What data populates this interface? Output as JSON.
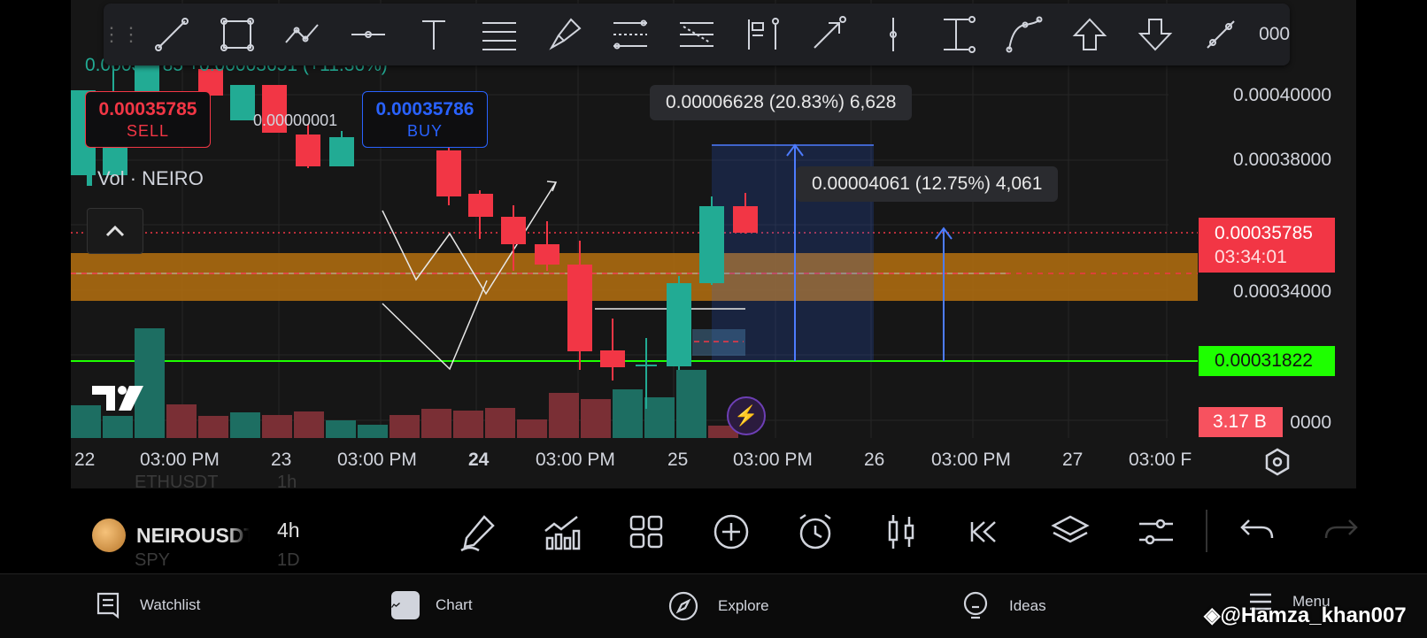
{
  "colors": {
    "up": "#22ab94",
    "down": "#f23645",
    "buy": "#2962ff",
    "support": "#1eff00",
    "zone": "#b5700f"
  },
  "toolbar": {
    "tools": [
      "trend-line-icon",
      "rectangle-icon",
      "path-icon",
      "horizontal-ray-icon",
      "text-icon",
      "parallel-channel-icon",
      "brush-icon",
      "fib-retracement-icon",
      "fib-extension-icon",
      "long-position-icon",
      "arrow-icon",
      "vertical-line-icon",
      "price-range-icon",
      "curve-icon",
      "arrow-up-icon",
      "arrow-down-icon",
      "info-line-icon"
    ],
    "peek_price": "000"
  },
  "chart": {
    "ohlc_change": "0.00035785 +0.00003651 (+11.36%)",
    "sell_price": "0.00035785",
    "sell_label": "SELL",
    "spread": "0.00000001",
    "buy_price": "0.00035786",
    "buy_label": "BUY",
    "volume_label": "Vol · NEIRO",
    "measure_1": "0.00006628 (20.83%) 6,628",
    "measure_2": "0.00004061 (12.75%) 4,061",
    "price_axis": [
      "0.00040000",
      "0.00038000",
      "0.00034000"
    ],
    "price_axis_bottom": "0000",
    "last_price": "0.00035785",
    "countdown": "03:34:01",
    "support_price": "0.00031822",
    "volume_value": "3.17 B",
    "time_axis": [
      "22",
      "03:00 PM",
      "23",
      "03:00 PM",
      "24",
      "03:00 PM",
      "25",
      "03:00 PM",
      "26",
      "03:00 PM",
      "27",
      "03:00 F"
    ]
  },
  "bottombar": {
    "ghost_symbol_top": "ETHUSDT",
    "ghost_interval_top": "1h",
    "symbol": "NEIROUSDT",
    "interval": "4h",
    "ghost_symbol_bottom": "SPY",
    "ghost_interval_bottom": "1D",
    "icons": [
      "draw-icon",
      "indicators-icon",
      "layouts-icon",
      "add-icon",
      "alert-icon",
      "chart-type-icon",
      "replay-icon",
      "layers-icon",
      "settings-sliders-icon",
      "undo-icon",
      "redo-icon"
    ]
  },
  "nav": {
    "watchlist": "Watchlist",
    "chart": "Chart",
    "explore": "Explore",
    "ideas": "Ideas",
    "menu": "Menu"
  },
  "watermark": "@Hamza_khan007"
}
